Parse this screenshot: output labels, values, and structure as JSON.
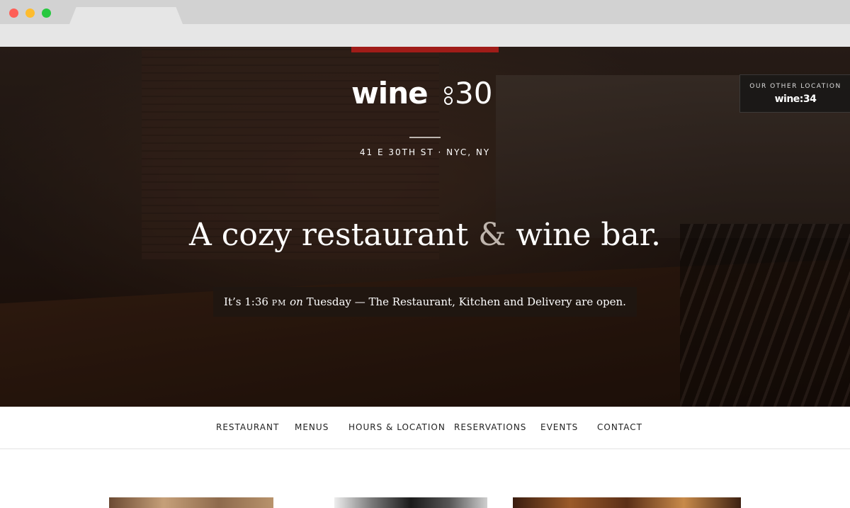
{
  "brand": {
    "logo_word": "wine",
    "logo_number": "30",
    "accent_color": "#a01c18"
  },
  "hero": {
    "address": "41 E 30TH ST · NYC, NY",
    "headline_part1": "A cozy restaurant",
    "headline_amp": "&",
    "headline_part2": "wine bar.",
    "status": {
      "prefix": "It’s 1:36",
      "ampm": "PM",
      "on": "on",
      "day": "Tuesday",
      "message": "— The Restaurant, Kitchen and Delivery are open."
    },
    "other_location": {
      "label": "OUR OTHER LOCATION",
      "logo": "wine:34"
    }
  },
  "nav": {
    "items": [
      {
        "label": "RESTAURANT"
      },
      {
        "label": "MENUS"
      },
      {
        "label": "HOURS & LOCATION"
      },
      {
        "label": "RESERVATIONS"
      },
      {
        "label": "EVENTS"
      },
      {
        "label": "CONTACT"
      }
    ]
  }
}
